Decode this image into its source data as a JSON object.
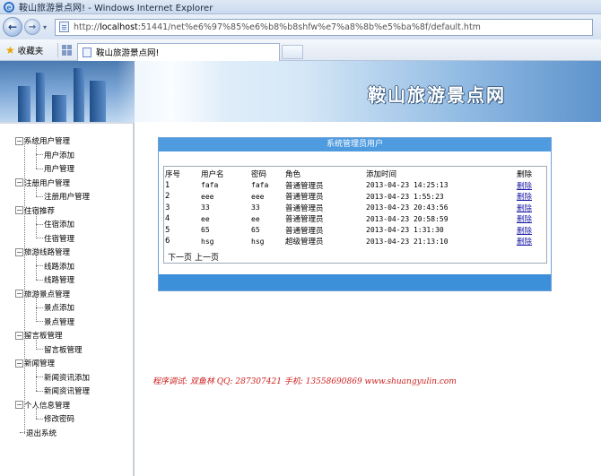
{
  "browser": {
    "window_title": "鞍山旅游景点网! - Windows Internet Explorer",
    "address_prefix": "http://",
    "address_host": "localhost",
    "address_rest": ":51441/net%e6%97%85%e6%b8%b8shfw%e7%a8%8b%e5%ba%8f/default.htm",
    "favorites_label": "收藏夹",
    "tab_title": "鞍山旅游景点网!"
  },
  "site_title": "鞍山旅游景点网",
  "sidebar": {
    "groups": [
      {
        "label": "系统用户管理",
        "items": [
          "用户添加",
          "用户管理"
        ]
      },
      {
        "label": "注册用户管理",
        "items": [
          "注册用户管理"
        ]
      },
      {
        "label": "住宿推荐",
        "items": [
          "住宿添加",
          "住宿管理"
        ]
      },
      {
        "label": "旅游线路管理",
        "items": [
          "线路添加",
          "线路管理"
        ]
      },
      {
        "label": "旅游景点管理",
        "items": [
          "景点添加",
          "景点管理"
        ]
      },
      {
        "label": "留言板管理",
        "items": [
          "留言板管理"
        ]
      },
      {
        "label": "新闻管理",
        "items": [
          "新闻资讯添加",
          "新闻资讯管理"
        ]
      },
      {
        "label": "个人信息管理",
        "items": [
          "修改密码"
        ]
      }
    ],
    "exit_label": "退出系统"
  },
  "panel": {
    "title": "系统管理员用户",
    "columns": [
      "序号",
      "用户名",
      "密码",
      "角色",
      "添加时间",
      "删除"
    ],
    "rows": [
      {
        "id": "1",
        "username": "fafa",
        "password": "fafa",
        "role": "普通管理员",
        "time": "2013-04-23 14:25:13",
        "action": "删除"
      },
      {
        "id": "2",
        "username": "eee",
        "password": "eee",
        "role": "普通管理员",
        "time": "2013-04-23 1:55:23",
        "action": "删除"
      },
      {
        "id": "3",
        "username": "33",
        "password": "33",
        "role": "普通管理员",
        "time": "2013-04-23 20:43:56",
        "action": "删除"
      },
      {
        "id": "4",
        "username": "ee",
        "password": "ee",
        "role": "普通管理员",
        "time": "2013-04-23 20:58:59",
        "action": "删除"
      },
      {
        "id": "5",
        "username": "65",
        "password": "65",
        "role": "普通管理员",
        "time": "2013-04-23 1:31:30",
        "action": "删除"
      },
      {
        "id": "6",
        "username": "hsg",
        "password": "hsg",
        "role": "超级管理员",
        "time": "2013-04-23 21:13:10",
        "action": "删除"
      }
    ],
    "pager": {
      "next": "下一页",
      "prev": "上一页"
    }
  },
  "footer": "程序调试: 双鱼林   QQ: 287307421   手机: 13558690869   www.shuangyulin.com",
  "colors": {
    "panel_header": "#4f9be0",
    "footer_text": "#cc1f1f",
    "link": "#1a1aa8"
  }
}
